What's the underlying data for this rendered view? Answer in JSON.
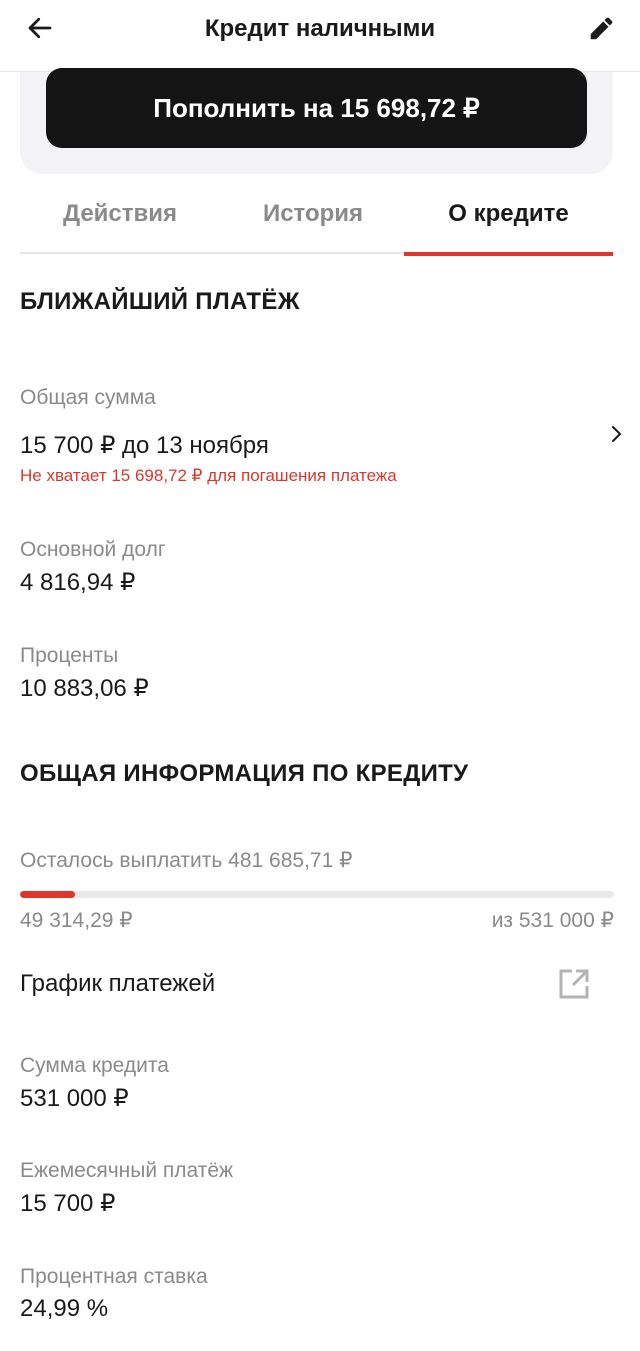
{
  "header": {
    "title": "Кредит наличными"
  },
  "pay_button": {
    "label": "Пополнить на 15 698,72 ₽"
  },
  "tabs": [
    {
      "label": "Действия",
      "active": false
    },
    {
      "label": "История",
      "active": false
    },
    {
      "label": "О кредите",
      "active": true
    }
  ],
  "next_payment": {
    "section_title": "БЛИЖАЙШИЙ ПЛАТЁЖ",
    "total_label": "Общая сумма",
    "total_value": "15 700 ₽ до 13 ноября",
    "warning": "Не хватает 15 698,72 ₽ для погашения платежа",
    "principal_label": "Основной долг",
    "principal_value": "4 816,94 ₽",
    "interest_label": "Проценты",
    "interest_value": "10 883,06 ₽"
  },
  "loan_info": {
    "section_title": "ОБЩАЯ ИНФОРМАЦИЯ ПО КРЕДИТУ",
    "remaining_text": "Осталось выплатить 481 685,71 ₽",
    "paid": "49 314,29 ₽",
    "total_of": "из 531 000 ₽",
    "progress_fraction": 0.0929,
    "schedule_label": "График платежей",
    "amount_label": "Сумма кредита",
    "amount_value": "531 000 ₽",
    "monthly_label": "Ежемесячный платёж",
    "monthly_value": "15 700 ₽",
    "rate_label": "Процентная ставка",
    "rate_value": "24,99 %"
  },
  "colors": {
    "accent": "#e0352b",
    "button": "#141414",
    "muted": "#8a8a8a"
  },
  "icons": {
    "back": "arrow-left-icon",
    "edit": "pencil-icon",
    "chevron": "chevron-right-icon",
    "external": "external-link-icon"
  }
}
